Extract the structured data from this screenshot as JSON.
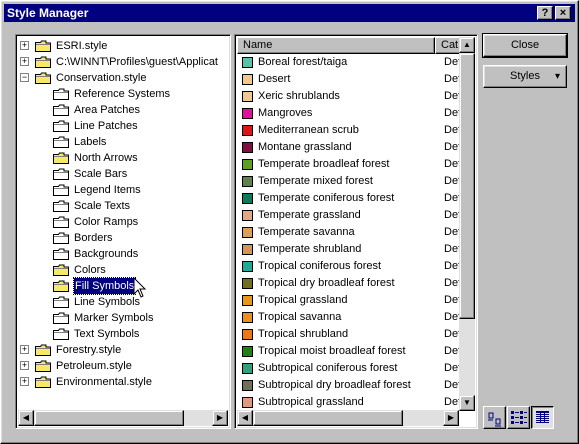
{
  "window": {
    "title": "Style Manager",
    "help_glyph": "?",
    "close_glyph": "×"
  },
  "tree": {
    "items": [
      {
        "label": "ESRI.style",
        "level": 0,
        "expander": "+"
      },
      {
        "label": "C:\\WINNT\\Profiles\\guest\\Applicat",
        "level": 0,
        "expander": "+"
      },
      {
        "label": "Conservation.style",
        "level": 0,
        "expander": "−"
      },
      {
        "label": "Reference Systems",
        "level": 1
      },
      {
        "label": "Area Patches",
        "level": 1
      },
      {
        "label": "Line Patches",
        "level": 1
      },
      {
        "label": "Labels",
        "level": 1
      },
      {
        "label": "North Arrows",
        "level": 1
      },
      {
        "label": "Scale Bars",
        "level": 1
      },
      {
        "label": "Legend Items",
        "level": 1
      },
      {
        "label": "Scale Texts",
        "level": 1
      },
      {
        "label": "Color Ramps",
        "level": 1
      },
      {
        "label": "Borders",
        "level": 1
      },
      {
        "label": "Backgrounds",
        "level": 1
      },
      {
        "label": "Colors",
        "level": 1
      },
      {
        "label": "Fill Symbols",
        "level": 1,
        "selected": true
      },
      {
        "label": "Line Symbols",
        "level": 1
      },
      {
        "label": "Marker Symbols",
        "level": 1
      },
      {
        "label": "Text Symbols",
        "level": 1
      },
      {
        "label": "Forestry.style",
        "level": 0,
        "expander": "+"
      },
      {
        "label": "Petroleum.style",
        "level": 0,
        "expander": "+"
      },
      {
        "label": "Environmental.style",
        "level": 0,
        "expander": "+"
      }
    ]
  },
  "list": {
    "columns": {
      "name": "Name",
      "category": "Cat"
    },
    "rows": [
      {
        "name": "Boreal forest/taiga",
        "category": "Def",
        "color": "#5fbfa8"
      },
      {
        "name": "Desert",
        "category": "Def",
        "color": "#f5c98a"
      },
      {
        "name": "Xeric shrublands",
        "category": "Def",
        "color": "#f0c898"
      },
      {
        "name": "Mangroves",
        "category": "Def",
        "color": "#e0109e"
      },
      {
        "name": "Mediterranean scrub",
        "category": "Def",
        "color": "#d81818"
      },
      {
        "name": "Montane grassland",
        "category": "Def",
        "color": "#801040"
      },
      {
        "name": "Temperate broadleaf forest",
        "category": "Def",
        "color": "#60a020"
      },
      {
        "name": "Temperate mixed forest",
        "category": "Def",
        "color": "#608050"
      },
      {
        "name": "Temperate coniferous forest",
        "category": "Def",
        "color": "#107858"
      },
      {
        "name": "Temperate grassland",
        "category": "Def",
        "color": "#e0a888"
      },
      {
        "name": "Temperate savanna",
        "category": "Def",
        "color": "#d8a060"
      },
      {
        "name": "Temperate shrubland",
        "category": "Def",
        "color": "#d09858"
      },
      {
        "name": "Tropical coniferous forest",
        "category": "Def",
        "color": "#20a898"
      },
      {
        "name": "Tropical dry broadleaf forest",
        "category": "Def",
        "color": "#707020"
      },
      {
        "name": "Tropical grassland",
        "category": "Def",
        "color": "#e89818"
      },
      {
        "name": "Tropical savanna",
        "category": "Def",
        "color": "#e89020"
      },
      {
        "name": "Tropical shrubland",
        "category": "Def",
        "color": "#e87818"
      },
      {
        "name": "Tropical moist broadleaf forest",
        "category": "Def",
        "color": "#208010"
      },
      {
        "name": "Subtropical coniferous forest",
        "category": "Def",
        "color": "#30a078"
      },
      {
        "name": "Subtropical dry broadleaf forest",
        "category": "Def",
        "color": "#707058"
      },
      {
        "name": "Subtropical grassland",
        "category": "Def",
        "color": "#e09880"
      }
    ]
  },
  "buttons": {
    "close": "Close",
    "styles": "Styles",
    "styles_arrow": "▾"
  },
  "view_modes": [
    {
      "icon": "large-icons-view-icon"
    },
    {
      "icon": "list-view-icon"
    },
    {
      "icon": "details-view-icon",
      "pressed": true
    }
  ],
  "scroll": {
    "up": "▲",
    "down": "▼",
    "left": "◀",
    "right": "▶"
  }
}
